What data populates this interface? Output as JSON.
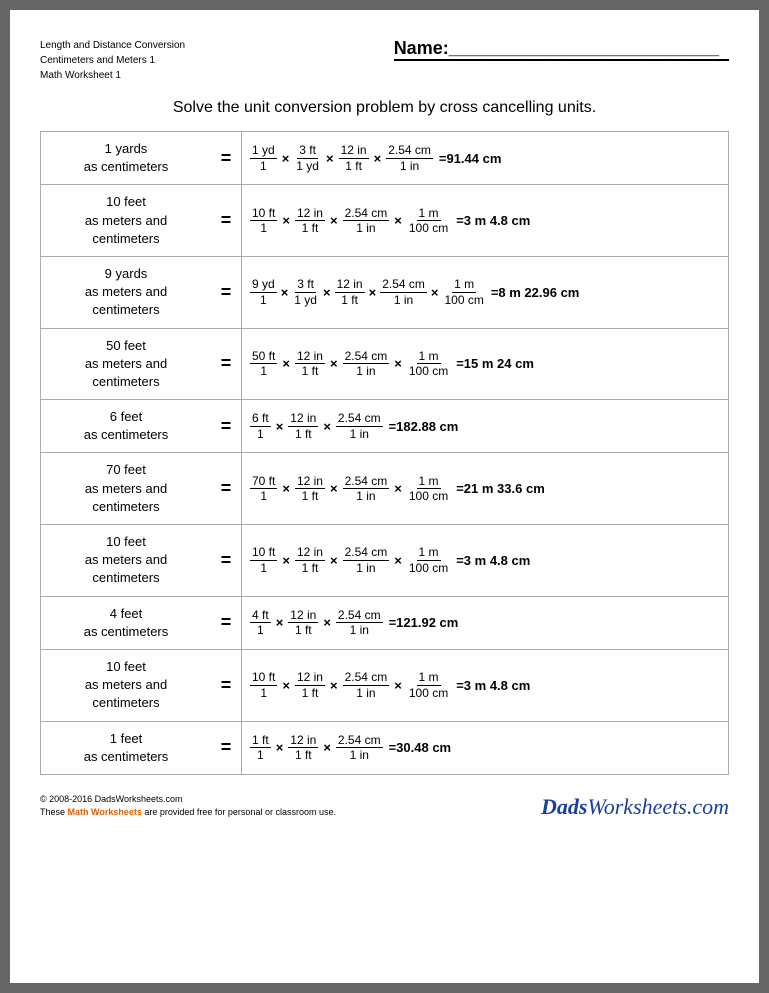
{
  "header": {
    "left_line1": "Length and Distance Conversion",
    "left_line2": "Centimeters and Meters 1",
    "left_line3": "Math Worksheet 1",
    "name_label": "Name:___________________________"
  },
  "title": "Solve the unit conversion problem by cross cancelling units.",
  "problems": [
    {
      "label_line1": "1 yards",
      "label_line2": "as centimeters",
      "formula_html": "frac(1 yd,1) × frac(3 ft,1 yd) × frac(12 in,1 ft) × frac(2.54 cm,1 in) =91.44 cm"
    },
    {
      "label_line1": "10 feet",
      "label_line2": "as meters and",
      "label_line3": "centimeters",
      "formula_html": "frac(10 ft,1) × frac(12 in,1 ft) × frac(2.54 cm,1 in) × frac(1 m,100 cm) =3 m 4.8 cm"
    },
    {
      "label_line1": "9 yards",
      "label_line2": "as meters and",
      "label_line3": "centimeters",
      "formula_html": "frac(9 yd,1) × frac(3 ft,1 yd) × frac(12 in,1 ft) × frac(2.54 cm,1 in) × frac(1 m,100 cm) =8 m 22.96 cm"
    },
    {
      "label_line1": "50 feet",
      "label_line2": "as meters and",
      "label_line3": "centimeters",
      "formula_html": "frac(50 ft,1) × frac(12 in,1 ft) × frac(2.54 cm,1 in) × frac(1 m,100 cm) =15 m 24 cm"
    },
    {
      "label_line1": "6 feet",
      "label_line2": "as centimeters",
      "formula_html": "frac(6 ft,1) × frac(12 in,1 ft) × frac(2.54 cm,1 in) =182.88 cm"
    },
    {
      "label_line1": "70 feet",
      "label_line2": "as meters and",
      "label_line3": "centimeters",
      "formula_html": "frac(70 ft,1) × frac(12 in,1 ft) × frac(2.54 cm,1 in) × frac(1 m,100 cm) =21 m 33.6 cm"
    },
    {
      "label_line1": "10 feet",
      "label_line2": "as meters and",
      "label_line3": "centimeters",
      "formula_html": "frac(10 ft,1) × frac(12 in,1 ft) × frac(2.54 cm,1 in) × frac(1 m,100 cm) =3 m 4.8 cm"
    },
    {
      "label_line1": "4 feet",
      "label_line2": "as centimeters",
      "formula_html": "frac(4 ft,1) × frac(12 in,1 ft) × frac(2.54 cm,1 in) =121.92 cm"
    },
    {
      "label_line1": "10 feet",
      "label_line2": "as meters and",
      "label_line3": "centimeters",
      "formula_html": "frac(10 ft,1) × frac(12 in,1 ft) × frac(2.54 cm,1 in) × frac(1 m,100 cm) =3 m 4.8 cm"
    },
    {
      "label_line1": "1 feet",
      "label_line2": "as centimeters",
      "formula_html": "frac(1 ft,1) × frac(12 in,1 ft) × frac(2.54 cm,1 in) =30.48 cm"
    }
  ],
  "footer": {
    "copyright": "© 2008-2016 DadsWorksheets.com",
    "note_plain": "These ",
    "note_link": "Math Worksheets",
    "note_end": " are provided free for personal or classroom use.",
    "logo": "DadsWorksheets.com"
  }
}
